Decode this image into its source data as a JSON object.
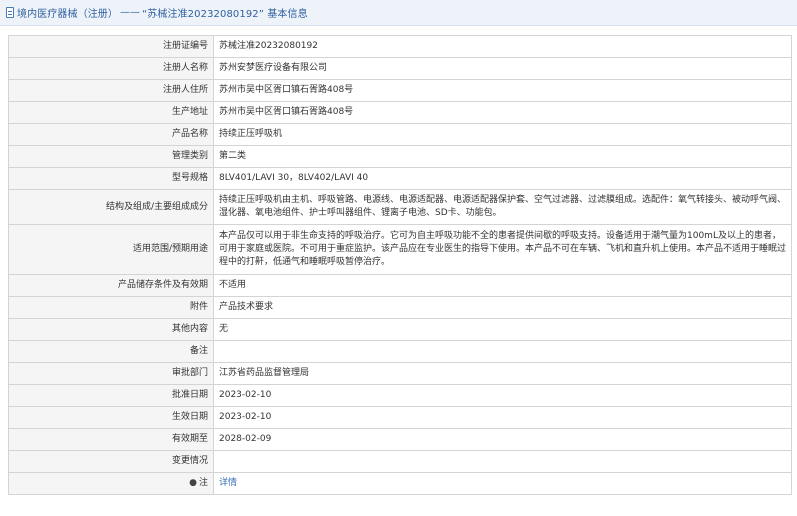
{
  "header": {
    "section": "境内医疗器械（注册）",
    "separator": "——",
    "record_title": "“苏械注准20232080192” 基本信息"
  },
  "rows": [
    {
      "label": "注册证编号",
      "value": "苏械注准20232080192"
    },
    {
      "label": "注册人名称",
      "value": "苏州安梦医疗设备有限公司"
    },
    {
      "label": "注册人住所",
      "value": "苏州市吴中区胥口镇石胥路408号"
    },
    {
      "label": "生产地址",
      "value": "苏州市吴中区胥口镇石胥路408号"
    },
    {
      "label": "产品名称",
      "value": "持续正压呼吸机"
    },
    {
      "label": "管理类别",
      "value": "第二类"
    },
    {
      "label": "型号规格",
      "value": "8LV401/LAVI 30，8LV402/LAVI 40"
    },
    {
      "label": "结构及组成/主要组成成分",
      "value": "持续正压呼吸机由主机、呼吸管路、电源线、电源适配器、电源适配器保护套、空气过滤器、过滤膜组成。选配件：氧气转接头、被动呼气阀、湿化器、氧电池组件、护士呼叫器组件、锂离子电池、SD卡、功能包。"
    },
    {
      "label": "适用范围/预期用途",
      "value": "本产品仅可以用于非生命支持的呼吸治疗。它可为自主呼吸功能不全的患者提供间歇的呼吸支持。设备适用于潮气量为100mL及以上的患者，可用于家庭或医院。不可用于重症监护。该产品应在专业医生的指导下使用。本产品不可在车辆、飞机和直升机上使用。本产品不适用于睡眠过程中的打鼾，低通气和睡眠呼吸暂停治疗。"
    },
    {
      "label": "产品储存条件及有效期",
      "value": "不适用"
    },
    {
      "label": "附件",
      "value": "产品技术要求"
    },
    {
      "label": "其他内容",
      "value": "无"
    },
    {
      "label": "备注",
      "value": ""
    },
    {
      "label": "审批部门",
      "value": "江苏省药品监督管理局"
    },
    {
      "label": "批准日期",
      "value": "2023-02-10"
    },
    {
      "label": "生效日期",
      "value": "2023-02-10"
    },
    {
      "label": "有效期至",
      "value": "2028-02-09"
    },
    {
      "label": "变更情况",
      "value": ""
    }
  ],
  "note_row": {
    "icon": "note-icon",
    "label": "注",
    "link_text": "详情"
  }
}
